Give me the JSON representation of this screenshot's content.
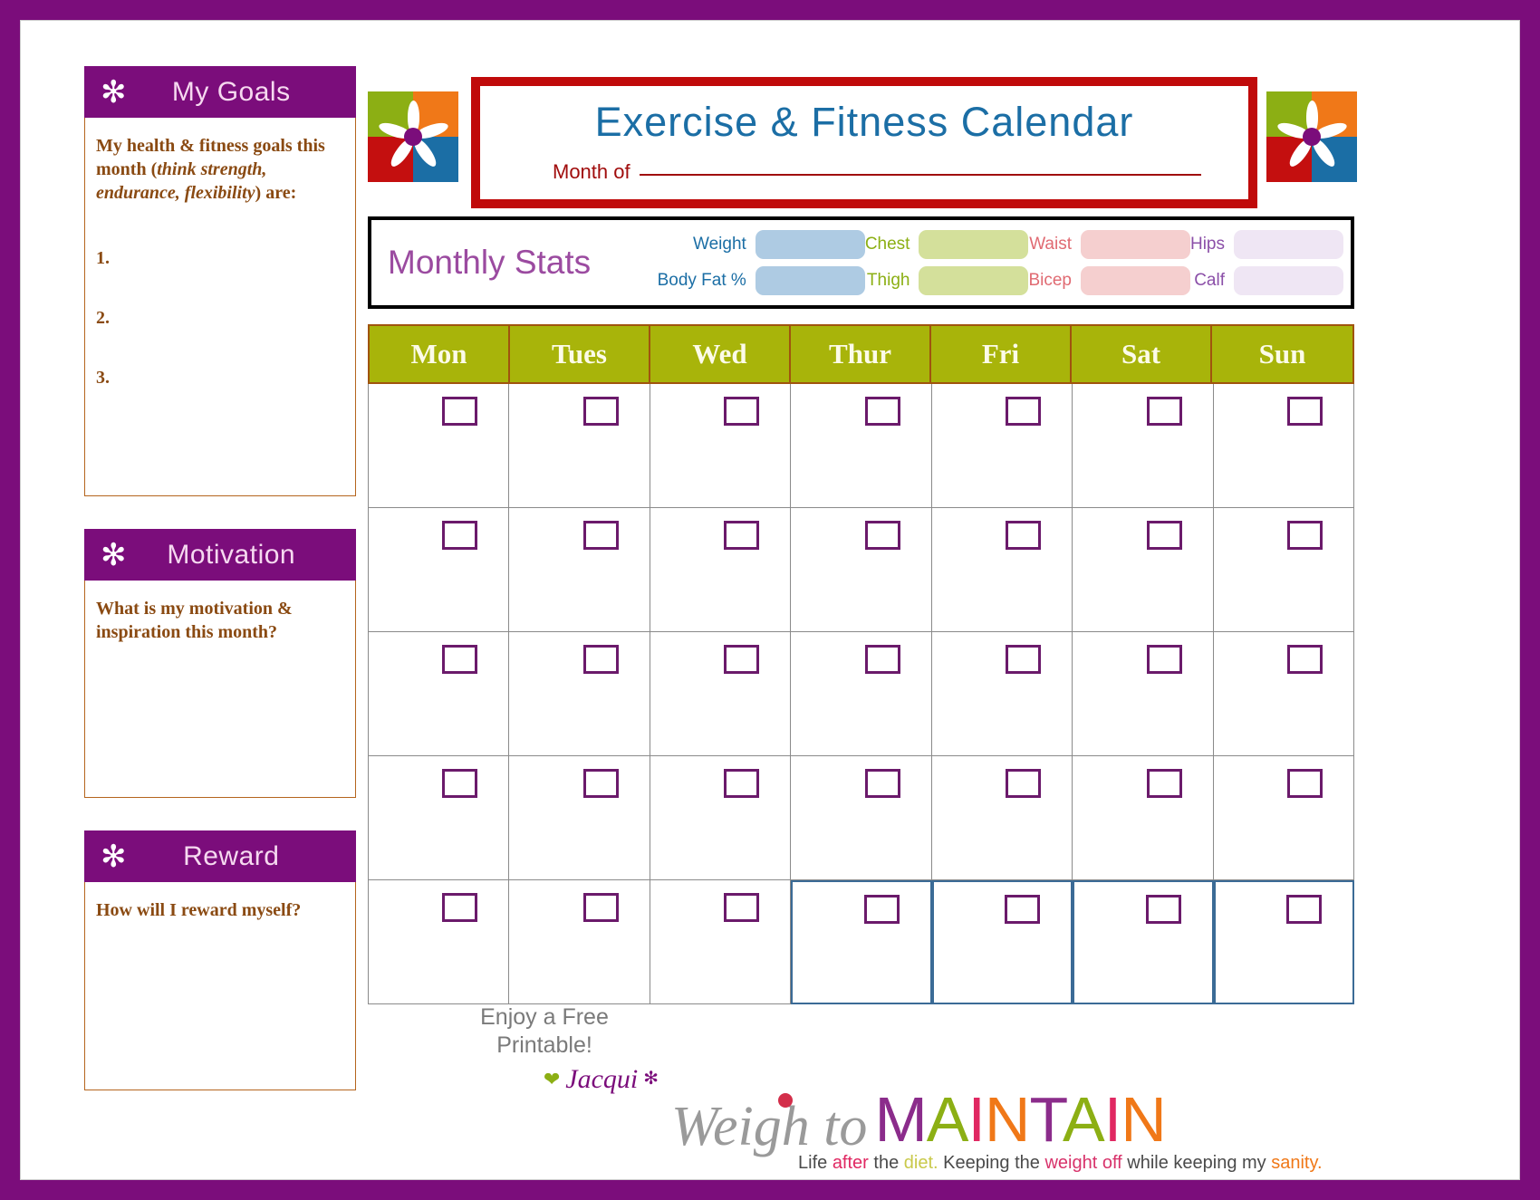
{
  "page": {
    "border_color": "#7B0D7B",
    "background": "#ffffff"
  },
  "header": {
    "title": "Exercise & Fitness Calendar",
    "title_color": "#1B6EA5",
    "month_label": "Month of",
    "month_value": "",
    "box_border_color": "#C00A0A"
  },
  "logo": {
    "name": "flower-logo",
    "colors": {
      "top_left": "#8CAF14",
      "top_right": "#F07818",
      "bottom_left": "#C40F0F",
      "bottom_right": "#1B6EA5",
      "center": "#7B0D7B"
    }
  },
  "sidebar": {
    "panels": [
      {
        "id": "goals",
        "icon": "asterisk-icon",
        "title": "My Goals",
        "prompt_part1": "My health & fitness goals this month (",
        "prompt_em": "think strength, endurance, flexibility",
        "prompt_part2": ") are:",
        "items": [
          "1.",
          "2.",
          "3."
        ]
      },
      {
        "id": "motivation",
        "icon": "asterisk-icon",
        "title": "Motivation",
        "prompt": "What is my motivation & inspiration this month?"
      },
      {
        "id": "reward",
        "icon": "asterisk-icon",
        "title": "Reward",
        "prompt": "How will I reward myself?"
      }
    ],
    "header_bg": "#7B0D7B",
    "header_text_color": "#f6d9f0",
    "body_border_color": "#b5651d",
    "body_text_color": "#8a4a12"
  },
  "monthly_stats": {
    "title": "Monthly Stats",
    "title_color": "#9B4BA0",
    "fields": [
      {
        "label": "Weight",
        "value": "",
        "label_color": "#1B6EA5",
        "field_color": "#AECBE3"
      },
      {
        "label": "Chest",
        "value": "",
        "label_color": "#8CAF14",
        "field_color": "#D4E09B"
      },
      {
        "label": "Waist",
        "value": "",
        "label_color": "#E06A72",
        "field_color": "#F5CFCF"
      },
      {
        "label": "Hips",
        "value": "",
        "label_color": "#8B4FA8",
        "field_color": "#EFE6F4"
      },
      {
        "label": "Body Fat %",
        "value": "",
        "label_color": "#1B6EA5",
        "field_color": "#AECBE3"
      },
      {
        "label": "Thigh",
        "value": "",
        "label_color": "#8CAF14",
        "field_color": "#D4E09B"
      },
      {
        "label": "Bicep",
        "value": "",
        "label_color": "#E06A72",
        "field_color": "#F5CFCF"
      },
      {
        "label": "Calf",
        "value": "",
        "label_color": "#8B4FA8",
        "field_color": "#EFE6F4"
      }
    ]
  },
  "calendar": {
    "day_headers": [
      "Mon",
      "Tues",
      "Wed",
      "Thur",
      "Fri",
      "Sat",
      "Sun"
    ],
    "header_bg": "#A8B40A",
    "header_text_color": "#FCFBE8",
    "header_border_color": "#A0540E",
    "grid_line_color": "#8a8a8a",
    "checkbox_color": "#6B1A6B",
    "rows": 5,
    "columns": 7,
    "highlight_border_color": "#3B6B96",
    "highlighted_cells": [
      {
        "row": 5,
        "col": 4
      },
      {
        "row": 5,
        "col": 5
      },
      {
        "row": 5,
        "col": 6
      },
      {
        "row": 5,
        "col": 7
      }
    ],
    "cell_values": [
      [
        "",
        "",
        "",
        "",
        "",
        "",
        ""
      ],
      [
        "",
        "",
        "",
        "",
        "",
        "",
        ""
      ],
      [
        "",
        "",
        "",
        "",
        "",
        "",
        ""
      ],
      [
        "",
        "",
        "",
        "",
        "",
        "",
        ""
      ],
      [
        "",
        "",
        "",
        "",
        "",
        "",
        ""
      ]
    ]
  },
  "footer": {
    "free_printable_line1": "Enjoy a Free",
    "free_printable_line2": "Printable!",
    "heart_icon": "heart-icon",
    "signature": "Jacqui",
    "signature_star": "✻",
    "brand": {
      "script": "Weigh to",
      "main_letters": [
        {
          "char": "M",
          "color": "#8B2C8B"
        },
        {
          "char": "A",
          "color": "#8CAF14"
        },
        {
          "char": "I",
          "color": "#E02862"
        },
        {
          "char": "N",
          "color": "#F07818"
        },
        {
          "char": "T",
          "color": "#8B2C8B"
        },
        {
          "char": "A",
          "color": "#8CAF14"
        },
        {
          "char": "I",
          "color": "#E02862"
        },
        {
          "char": "N",
          "color": "#F07818"
        }
      ],
      "tagline": {
        "s1": "Life ",
        "s2_after": "after",
        "s3": " the ",
        "s4_diet": "diet.",
        "s5": " Keeping the ",
        "s6_weight": "weight off",
        "s7": " while keeping my ",
        "s8_sanity": "sanity."
      }
    }
  }
}
